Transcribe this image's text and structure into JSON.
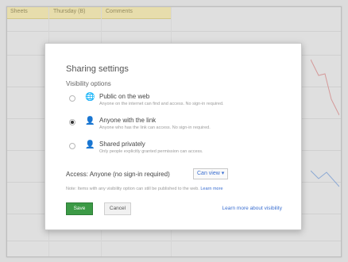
{
  "sheet": {
    "columns": [
      "Sheets",
      "Thursday (B)",
      "Comments"
    ]
  },
  "dialog": {
    "title": "Sharing settings",
    "visibility_label": "Visibility options",
    "options": [
      {
        "title": "Public on the web",
        "desc": "Anyone on the internet can find and access. No sign-in required.",
        "icon": "globe-icon",
        "selected": false
      },
      {
        "title": "Anyone with the link",
        "desc": "Anyone who has the link can access. No sign-in required.",
        "icon": "person-link-icon",
        "selected": true
      },
      {
        "title": "Shared privately",
        "desc": "Only people explicitly granted permission can access.",
        "icon": "person-lock-icon",
        "selected": false
      }
    ],
    "access_label": "Access:  Anyone (no sign-in required)",
    "access_value": "Can view ▾",
    "note_text": "Note: Items with any visibility option can still be published to the web.",
    "note_link": "Learn more",
    "save_label": "Save",
    "cancel_label": "Cancel",
    "learn_link": "Learn more about visibility"
  },
  "colors": {
    "save_green": "#3c9a46",
    "link_blue": "#3b6fd1",
    "header_yellow": "#fff3b8"
  }
}
